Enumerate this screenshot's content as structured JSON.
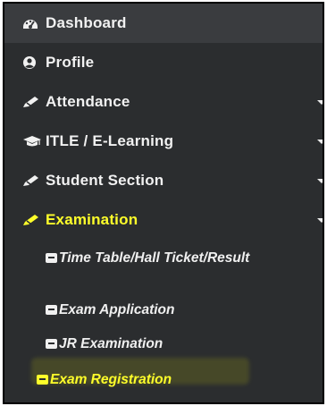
{
  "menu": {
    "items": [
      {
        "label": "Dashboard",
        "icon": "dashboard-icon",
        "expandable": false
      },
      {
        "label": "Profile",
        "icon": "profile-icon",
        "expandable": false
      },
      {
        "label": "Attendance",
        "icon": "pencil-icon",
        "expandable": true
      },
      {
        "label": "ITLE / E-Learning",
        "icon": "graduation-cap-icon",
        "expandable": true
      },
      {
        "label": "Student Section",
        "icon": "pencil-icon",
        "expandable": true
      },
      {
        "label": "Examination",
        "icon": "pencil-icon",
        "expandable": true,
        "active": true
      }
    ],
    "submenu": [
      {
        "label": "Time Table/Hall Ticket/Result",
        "icon": "book-icon"
      },
      {
        "label": "Exam Application",
        "icon": "book-icon"
      },
      {
        "label": "JR Examination",
        "icon": "book-icon"
      },
      {
        "label": "Exam Registration",
        "icon": "book-icon",
        "highlighted": true
      }
    ]
  },
  "colors": {
    "background": "#2b2d2f",
    "text": "#f1f1f1",
    "highlight": "#ffff2a"
  }
}
